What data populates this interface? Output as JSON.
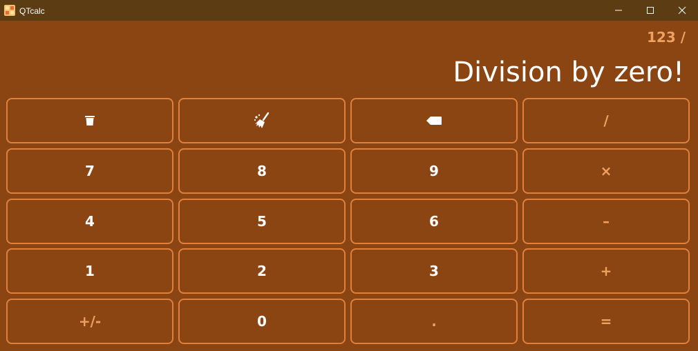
{
  "window": {
    "title": "QTcalc",
    "titlebar_color": "#5c3d13",
    "background_color": "#8b4513"
  },
  "display": {
    "expression": "123 /",
    "result": "Division by zero!"
  },
  "colors": {
    "accent": "#f0a05f",
    "key_border": "#e0803c",
    "text": "#ffffff"
  },
  "keys": {
    "clear_all_icon": "trash-icon",
    "clear_entry_icon": "broom-icon",
    "backspace_icon": "backspace-icon",
    "divide": "/",
    "seven": "7",
    "eight": "8",
    "nine": "9",
    "multiply": "×",
    "four": "4",
    "five": "5",
    "six": "6",
    "minus": "–",
    "one": "1",
    "two": "2",
    "three": "3",
    "plus": "+",
    "negate": "+/-",
    "zero": "0",
    "decimal": ".",
    "equals": "="
  }
}
